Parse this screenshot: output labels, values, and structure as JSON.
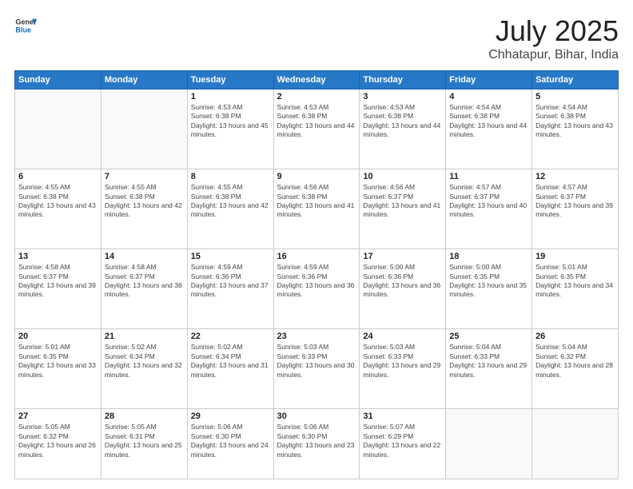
{
  "logo": {
    "general": "General",
    "blue": "Blue"
  },
  "title": {
    "month_year": "July 2025",
    "location": "Chhatapur, Bihar, India"
  },
  "weekdays": [
    "Sunday",
    "Monday",
    "Tuesday",
    "Wednesday",
    "Thursday",
    "Friday",
    "Saturday"
  ],
  "weeks": [
    [
      {
        "day": "",
        "info": ""
      },
      {
        "day": "",
        "info": ""
      },
      {
        "day": "1",
        "info": "Sunrise: 4:53 AM\nSunset: 6:38 PM\nDaylight: 13 hours and 45 minutes."
      },
      {
        "day": "2",
        "info": "Sunrise: 4:53 AM\nSunset: 6:38 PM\nDaylight: 13 hours and 44 minutes."
      },
      {
        "day": "3",
        "info": "Sunrise: 4:53 AM\nSunset: 6:38 PM\nDaylight: 13 hours and 44 minutes."
      },
      {
        "day": "4",
        "info": "Sunrise: 4:54 AM\nSunset: 6:38 PM\nDaylight: 13 hours and 44 minutes."
      },
      {
        "day": "5",
        "info": "Sunrise: 4:54 AM\nSunset: 6:38 PM\nDaylight: 13 hours and 43 minutes."
      }
    ],
    [
      {
        "day": "6",
        "info": "Sunrise: 4:55 AM\nSunset: 6:38 PM\nDaylight: 13 hours and 43 minutes."
      },
      {
        "day": "7",
        "info": "Sunrise: 4:55 AM\nSunset: 6:38 PM\nDaylight: 13 hours and 42 minutes."
      },
      {
        "day": "8",
        "info": "Sunrise: 4:55 AM\nSunset: 6:38 PM\nDaylight: 13 hours and 42 minutes."
      },
      {
        "day": "9",
        "info": "Sunrise: 4:56 AM\nSunset: 6:38 PM\nDaylight: 13 hours and 41 minutes."
      },
      {
        "day": "10",
        "info": "Sunrise: 4:56 AM\nSunset: 6:37 PM\nDaylight: 13 hours and 41 minutes."
      },
      {
        "day": "11",
        "info": "Sunrise: 4:57 AM\nSunset: 6:37 PM\nDaylight: 13 hours and 40 minutes."
      },
      {
        "day": "12",
        "info": "Sunrise: 4:57 AM\nSunset: 6:37 PM\nDaylight: 13 hours and 39 minutes."
      }
    ],
    [
      {
        "day": "13",
        "info": "Sunrise: 4:58 AM\nSunset: 6:37 PM\nDaylight: 13 hours and 39 minutes."
      },
      {
        "day": "14",
        "info": "Sunrise: 4:58 AM\nSunset: 6:37 PM\nDaylight: 13 hours and 38 minutes."
      },
      {
        "day": "15",
        "info": "Sunrise: 4:59 AM\nSunset: 6:36 PM\nDaylight: 13 hours and 37 minutes."
      },
      {
        "day": "16",
        "info": "Sunrise: 4:59 AM\nSunset: 6:36 PM\nDaylight: 13 hours and 36 minutes."
      },
      {
        "day": "17",
        "info": "Sunrise: 5:00 AM\nSunset: 6:36 PM\nDaylight: 13 hours and 36 minutes."
      },
      {
        "day": "18",
        "info": "Sunrise: 5:00 AM\nSunset: 6:35 PM\nDaylight: 13 hours and 35 minutes."
      },
      {
        "day": "19",
        "info": "Sunrise: 5:01 AM\nSunset: 6:35 PM\nDaylight: 13 hours and 34 minutes."
      }
    ],
    [
      {
        "day": "20",
        "info": "Sunrise: 5:01 AM\nSunset: 6:35 PM\nDaylight: 13 hours and 33 minutes."
      },
      {
        "day": "21",
        "info": "Sunrise: 5:02 AM\nSunset: 6:34 PM\nDaylight: 13 hours and 32 minutes."
      },
      {
        "day": "22",
        "info": "Sunrise: 5:02 AM\nSunset: 6:34 PM\nDaylight: 13 hours and 31 minutes."
      },
      {
        "day": "23",
        "info": "Sunrise: 5:03 AM\nSunset: 6:33 PM\nDaylight: 13 hours and 30 minutes."
      },
      {
        "day": "24",
        "info": "Sunrise: 5:03 AM\nSunset: 6:33 PM\nDaylight: 13 hours and 29 minutes."
      },
      {
        "day": "25",
        "info": "Sunrise: 5:04 AM\nSunset: 6:33 PM\nDaylight: 13 hours and 29 minutes."
      },
      {
        "day": "26",
        "info": "Sunrise: 5:04 AM\nSunset: 6:32 PM\nDaylight: 13 hours and 28 minutes."
      }
    ],
    [
      {
        "day": "27",
        "info": "Sunrise: 5:05 AM\nSunset: 6:32 PM\nDaylight: 13 hours and 26 minutes."
      },
      {
        "day": "28",
        "info": "Sunrise: 5:05 AM\nSunset: 6:31 PM\nDaylight: 13 hours and 25 minutes."
      },
      {
        "day": "29",
        "info": "Sunrise: 5:06 AM\nSunset: 6:30 PM\nDaylight: 13 hours and 24 minutes."
      },
      {
        "day": "30",
        "info": "Sunrise: 5:06 AM\nSunset: 6:30 PM\nDaylight: 13 hours and 23 minutes."
      },
      {
        "day": "31",
        "info": "Sunrise: 5:07 AM\nSunset: 6:29 PM\nDaylight: 13 hours and 22 minutes."
      },
      {
        "day": "",
        "info": ""
      },
      {
        "day": "",
        "info": ""
      }
    ]
  ]
}
